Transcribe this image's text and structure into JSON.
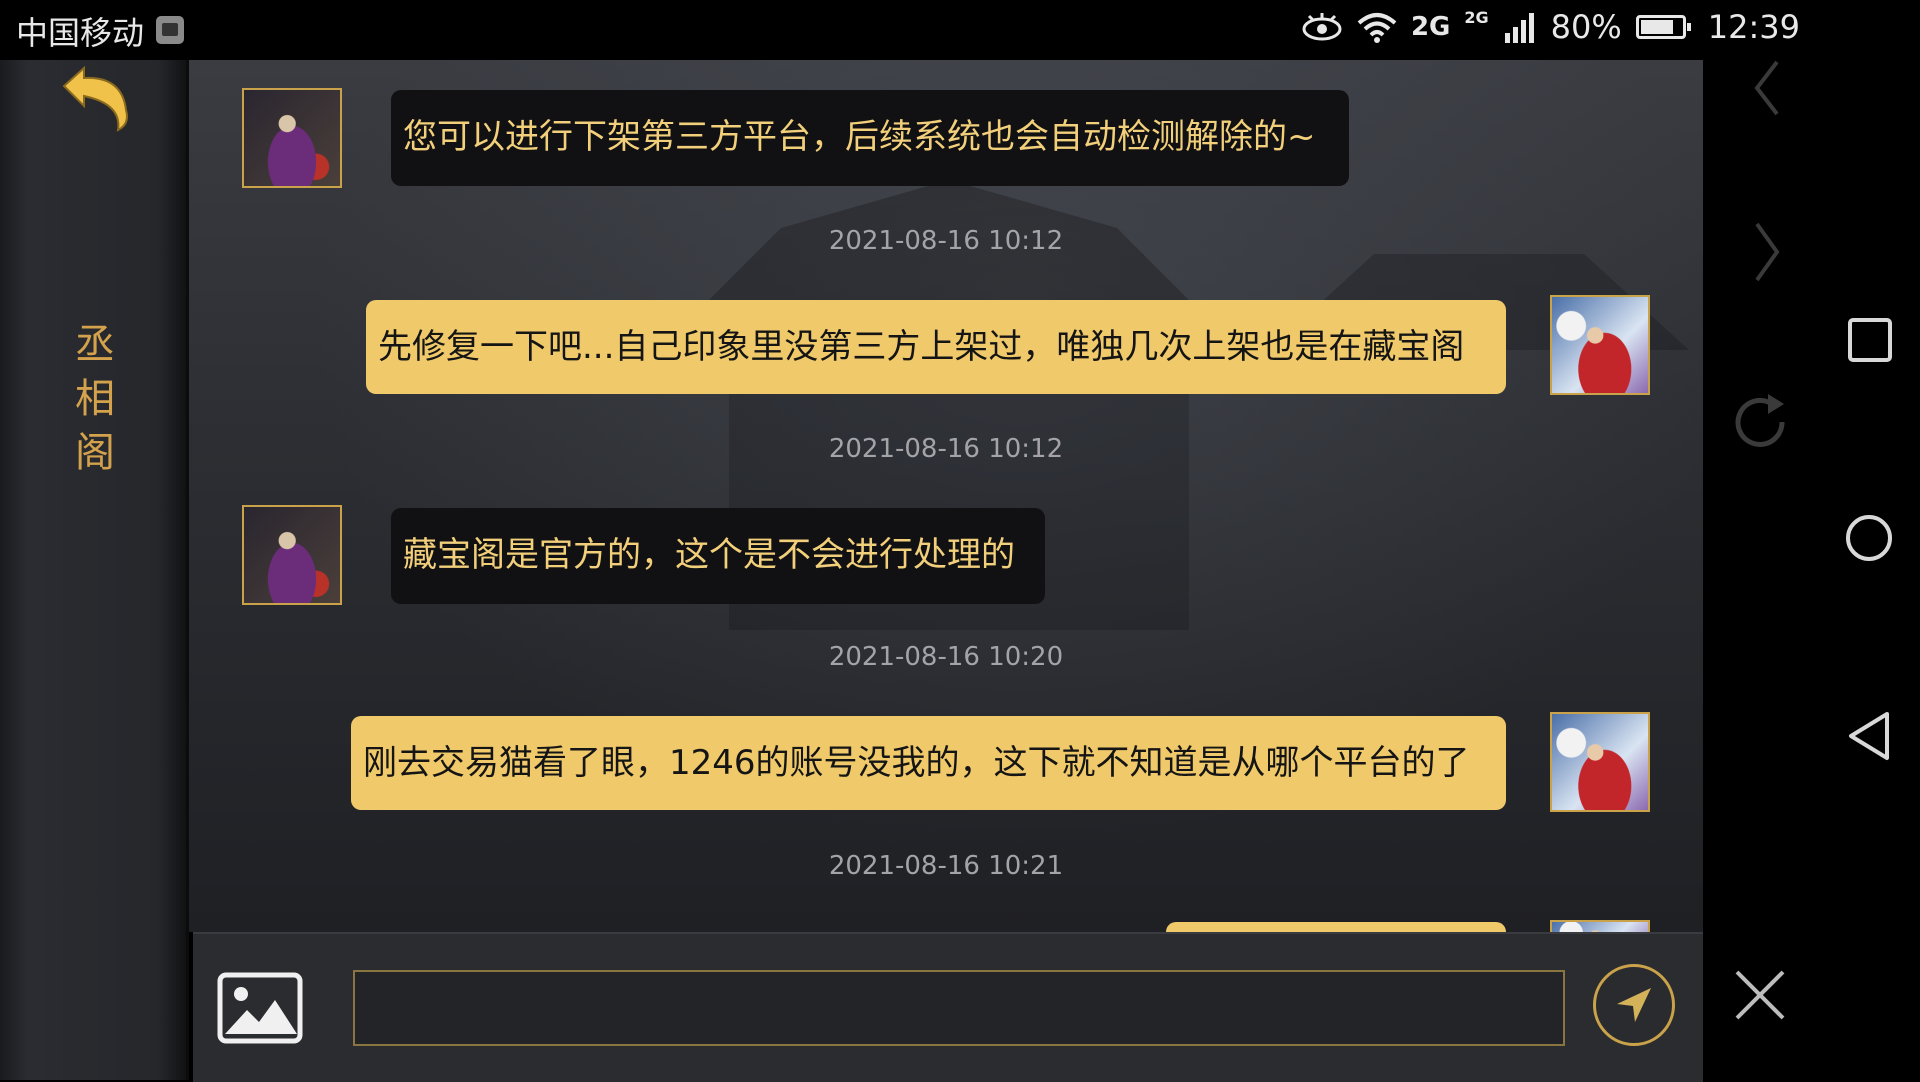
{
  "status_bar": {
    "carrier": "中国移动",
    "network_1": "2G",
    "network_2": "2G",
    "battery": "80%",
    "battery_level": 0.8,
    "time": "12:39",
    "icons": [
      "eye-icon",
      "wifi-icon",
      "signal-icon",
      "battery-icon"
    ]
  },
  "sidebar": {
    "back_icon": "back-arrow-icon",
    "channel_title": "丞\n相\n阁"
  },
  "messages": [
    {
      "sender": "them",
      "text": "您可以进行下架第三方平台，后续系统也会自动检测解除的~",
      "time": "2021-08-16 10:12"
    },
    {
      "sender": "me",
      "text": "先修复一下吧...自己印象里没第三方上架过，唯独几次上架也是在藏宝阁",
      "time": "2021-08-16 10:12"
    },
    {
      "sender": "them",
      "text": "藏宝阁是官方的，这个是不会进行处理的",
      "time": "2021-08-16 10:20"
    },
    {
      "sender": "me",
      "text": "刚去交易猫看了眼，1246的账号没我的，这下就不知道是从哪个平台的了",
      "time": "2021-08-16 10:21"
    }
  ],
  "input": {
    "value": "",
    "placeholder": ""
  },
  "colors": {
    "accent_gold": "#c9a24a",
    "my_bubble": "#f0c96a",
    "their_bubble": "#111113",
    "their_text": "#f2cf7a"
  },
  "system_nav": {
    "icons": [
      "chevron-left-icon",
      "chevron-right-icon",
      "square-icon",
      "refresh-icon",
      "circle-home-icon",
      "back-triangle-icon",
      "close-icon"
    ]
  }
}
